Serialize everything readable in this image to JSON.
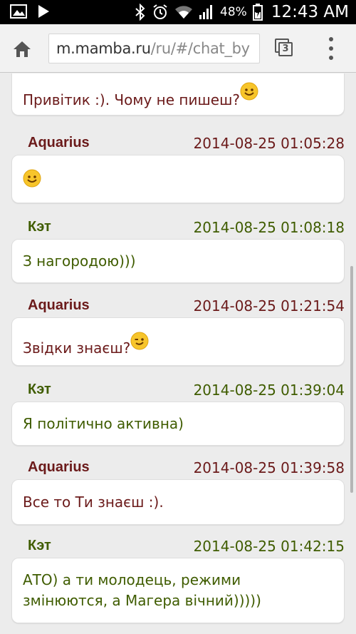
{
  "status_bar": {
    "battery_pct": "48%",
    "time": "12:43 AM",
    "icons": [
      "image-icon",
      "play-icon",
      "bluetooth-icon",
      "alarm-icon",
      "wifi-icon",
      "signal-icon",
      "battery-icon"
    ]
  },
  "browser": {
    "url_host": "m.mamba.ru",
    "url_path": "/ru/#/chat_by",
    "tab_count": "3"
  },
  "messages": [
    {
      "text": "Привітик :). Чому не пишеш?",
      "emoji": "smile"
    },
    {
      "author": "Aquarius",
      "time": "2014-08-25 01:05:28",
      "text": "",
      "emoji": "smile"
    },
    {
      "author": "Кэт",
      "time": "2014-08-25 01:08:18",
      "text": "З нагородою)))"
    },
    {
      "author": "Aquarius",
      "time": "2014-08-25 01:21:54",
      "text": "Звідки знаєш?",
      "emoji": "wink"
    },
    {
      "author": "Кэт",
      "time": "2014-08-25 01:39:04",
      "text": "Я політично активна)"
    },
    {
      "author": "Aquarius",
      "time": "2014-08-25 01:39:58",
      "text": "Все то Ти знаєш :)."
    },
    {
      "author": "Кэт",
      "time": "2014-08-25 01:42:15",
      "text_line1": "АТО) а ти молодець, режими",
      "text_line2": "змінюются, а Магера вічний)))))"
    }
  ]
}
